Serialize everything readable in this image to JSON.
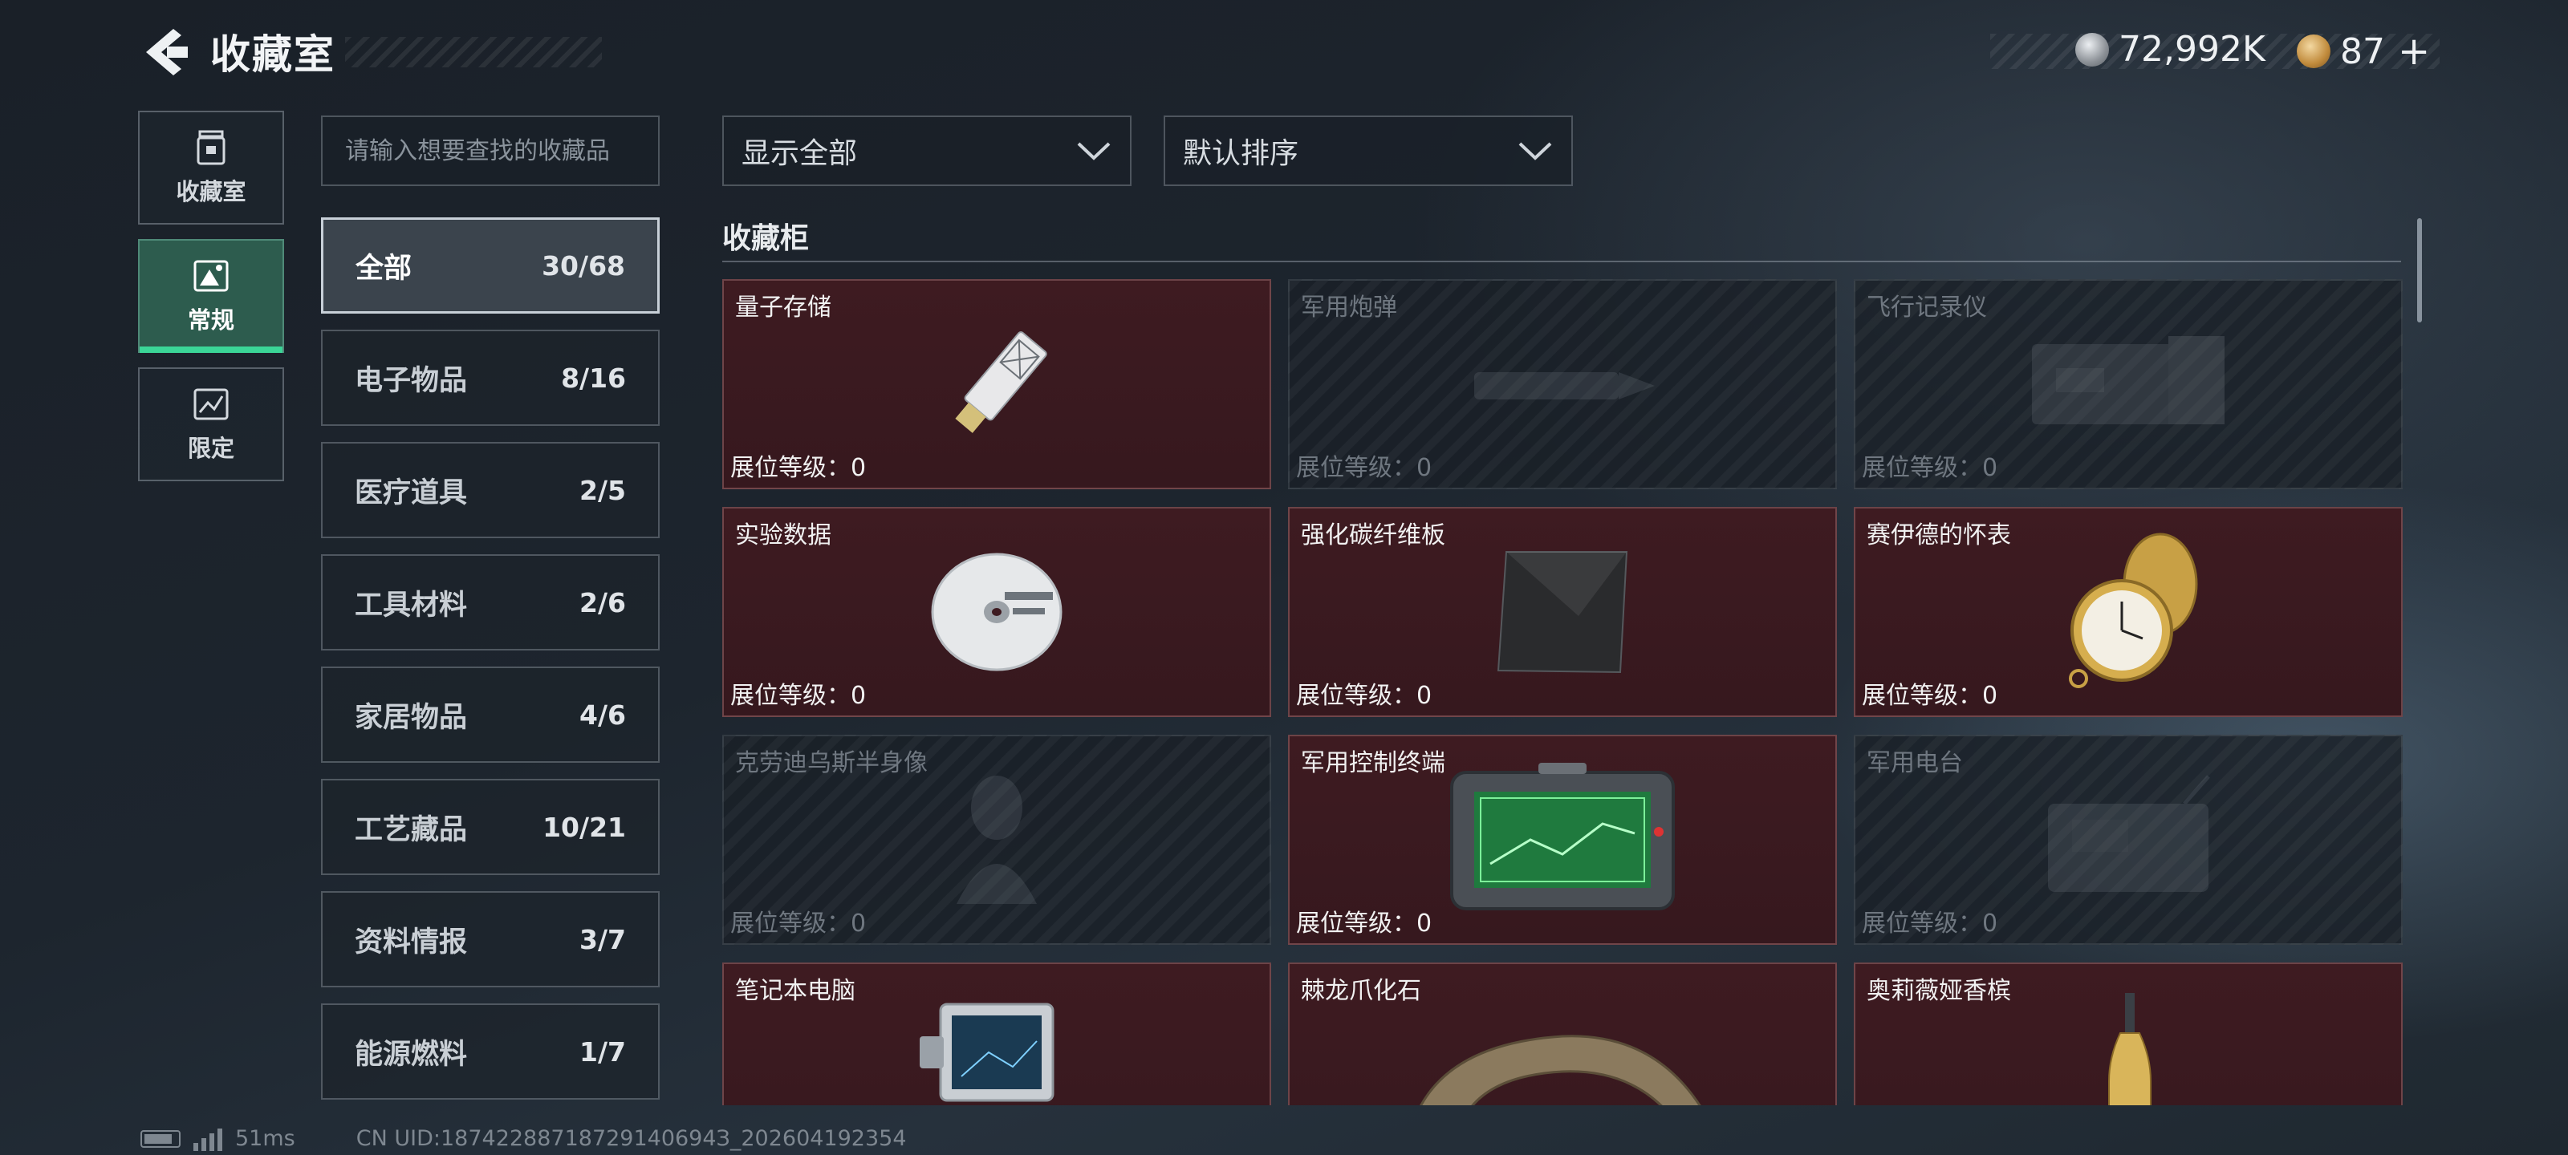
{
  "header": {
    "title": "收藏室",
    "currency_1": "72,992K",
    "currency_2": "87",
    "plus": "+"
  },
  "mode_tabs": [
    {
      "label": "收藏室",
      "icon": "trash-can-icon"
    },
    {
      "label": "常规",
      "icon": "image-frame-icon",
      "active": true
    },
    {
      "label": "限定",
      "icon": "limited-chart-icon"
    }
  ],
  "search": {
    "placeholder": "请输入想要查找的收藏品",
    "value": ""
  },
  "categories": [
    {
      "label": "全部",
      "count": "30/68",
      "active": true
    },
    {
      "label": "电子物品",
      "count": "8/16"
    },
    {
      "label": "医疗道具",
      "count": "2/5"
    },
    {
      "label": "工具材料",
      "count": "2/6"
    },
    {
      "label": "家居物品",
      "count": "4/6"
    },
    {
      "label": "工艺藏品",
      "count": "10/21"
    },
    {
      "label": "资料情报",
      "count": "3/7"
    },
    {
      "label": "能源燃料",
      "count": "1/7"
    }
  ],
  "filters": {
    "display": "显示全部",
    "sort": "默认排序"
  },
  "section_title": "收藏柜",
  "level_label": "展位等级：0",
  "items": [
    {
      "name": "量子存储",
      "owned": true,
      "icon": "usb-drive-icon"
    },
    {
      "name": "军用炮弹",
      "owned": false,
      "icon": "shell-icon"
    },
    {
      "name": "飞行记录仪",
      "owned": false,
      "icon": "flight-recorder-icon"
    },
    {
      "name": "实验数据",
      "owned": true,
      "icon": "disc-icon"
    },
    {
      "name": "强化碳纤维板",
      "owned": true,
      "icon": "carbon-plate-icon"
    },
    {
      "name": "赛伊德的怀表",
      "owned": true,
      "icon": "pocket-watch-icon"
    },
    {
      "name": "克劳迪乌斯半身像",
      "owned": false,
      "icon": "bust-icon"
    },
    {
      "name": "军用控制终端",
      "owned": true,
      "icon": "terminal-icon"
    },
    {
      "name": "军用电台",
      "owned": false,
      "icon": "radio-icon"
    },
    {
      "name": "笔记本电脑",
      "owned": true,
      "icon": "laptop-icon"
    },
    {
      "name": "棘龙爪化石",
      "owned": true,
      "icon": "claw-fossil-icon"
    },
    {
      "name": "奥莉薇娅香槟",
      "owned": true,
      "icon": "champagne-icon"
    }
  ],
  "footer": {
    "ping": "51ms",
    "uid": "CN UID:18742288718729140694З_202604192354"
  }
}
